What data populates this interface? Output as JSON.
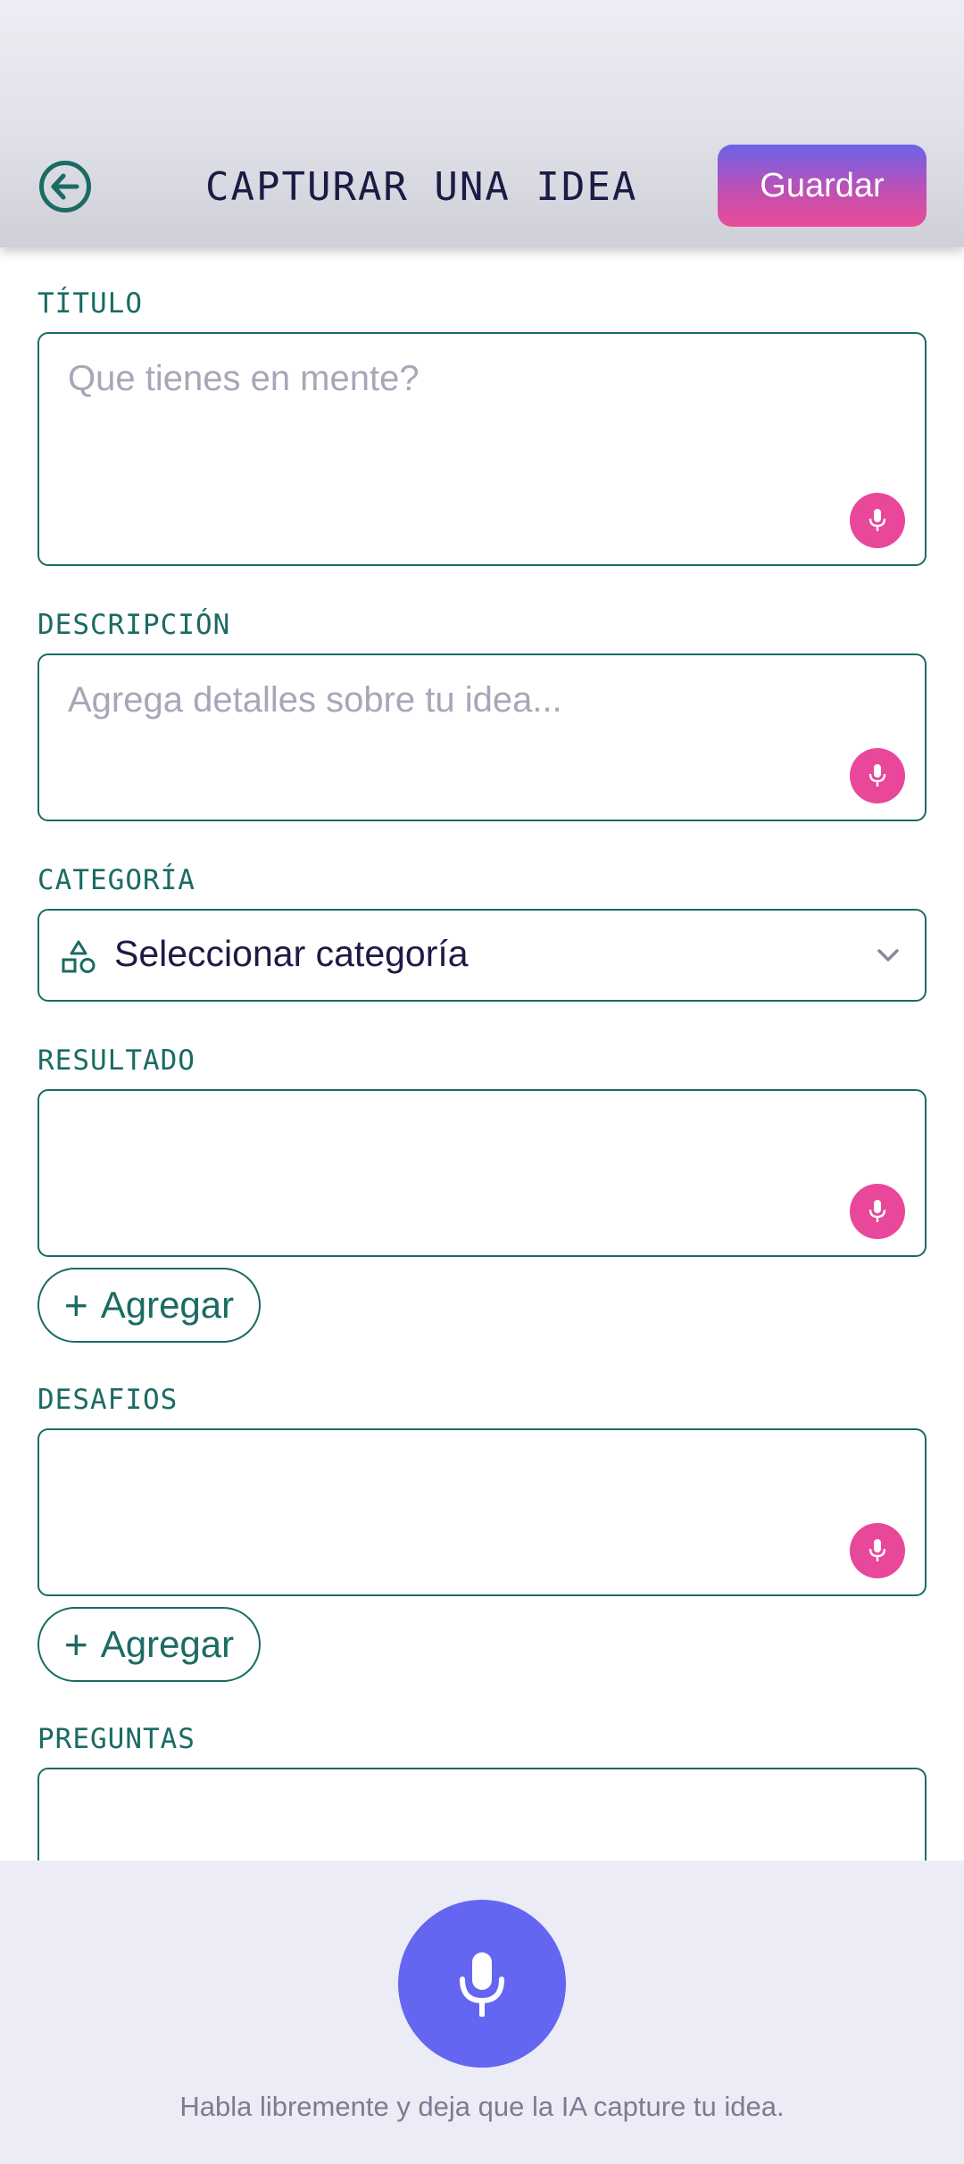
{
  "header": {
    "title": "CAPTURAR UNA IDEA",
    "save_label": "Guardar"
  },
  "fields": {
    "titulo": {
      "label": "TÍTULO",
      "placeholder": "Que tienes en mente?"
    },
    "descripcion": {
      "label": "DESCRIPCIÓN",
      "placeholder": "Agrega detalles sobre tu idea..."
    },
    "categoria": {
      "label": "CATEGORÍA",
      "selected": "Seleccionar categoría"
    },
    "resultado": {
      "label": "RESULTADO",
      "add_label": "Agregar"
    },
    "desafios": {
      "label": "DESAFIOS",
      "add_label": "Agregar"
    },
    "preguntas": {
      "label": "PREGUNTAS"
    }
  },
  "bottom": {
    "hint": "Habla libremente y deja que la IA capture tu idea."
  },
  "colors": {
    "accent_green": "#1a6b63",
    "mic_pink": "#e8479a",
    "voice_purple": "#6466f1"
  },
  "icons": {
    "back": "arrow-left-circle-icon",
    "field_mic": "microphone-icon",
    "category": "shapes-icon",
    "dropdown": "chevron-down-icon",
    "add": "plus-icon",
    "voice": "microphone-icon"
  }
}
